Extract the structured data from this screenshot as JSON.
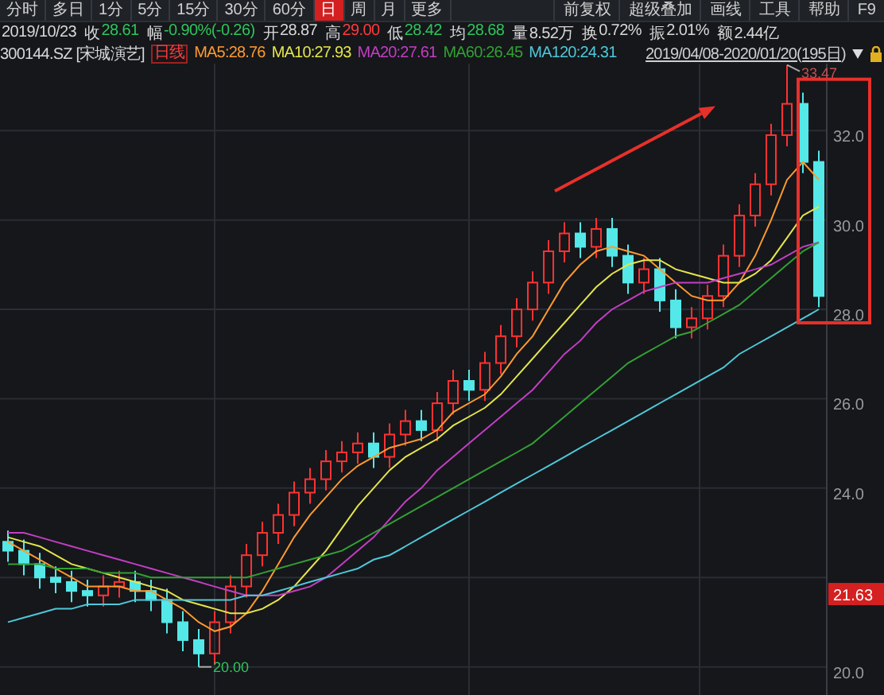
{
  "period_tabs": [
    {
      "label": "分时",
      "selected": false
    },
    {
      "label": "多日",
      "selected": false
    },
    {
      "label": "1分",
      "selected": false
    },
    {
      "label": "5分",
      "selected": false
    },
    {
      "label": "15分",
      "selected": false
    },
    {
      "label": "30分",
      "selected": false
    },
    {
      "label": "60分",
      "selected": false
    },
    {
      "label": "日",
      "selected": true
    },
    {
      "label": "周",
      "selected": false
    },
    {
      "label": "月",
      "selected": false
    },
    {
      "label": "更多",
      "selected": false
    }
  ],
  "tools": [
    "前复权",
    "超级叠加",
    "画线",
    "工具",
    "帮助",
    "F9"
  ],
  "quote": {
    "date": "2019/10/23",
    "items": [
      {
        "label": "收",
        "value": "28.61",
        "color": "#2fc45a"
      },
      {
        "label": "幅",
        "value": "-0.90%(-0.26)",
        "color": "#2fc45a"
      },
      {
        "label": "开",
        "value": "28.87",
        "color": "#d8d8d8"
      },
      {
        "label": "高",
        "value": "29.00",
        "color": "#ff3b3b"
      },
      {
        "label": "低",
        "value": "28.42",
        "color": "#2fc45a"
      },
      {
        "label": "均",
        "value": "28.68",
        "color": "#2fc45a"
      },
      {
        "label": "量",
        "value": "8.52万",
        "color": "#d8d8d8"
      },
      {
        "label": "换",
        "value": "0.72%",
        "color": "#d8d8d8"
      },
      {
        "label": "振",
        "value": "2.01%",
        "color": "#d8d8d8"
      },
      {
        "label": "额",
        "value": "2.44亿",
        "color": "#d8d8d8"
      }
    ]
  },
  "legend": {
    "symbol": "300144.SZ [宋城演艺]",
    "period": "日线",
    "range": "2019/04/08-2020/01/20(195日)",
    "locked": true
  },
  "chart_data": {
    "type": "candlestick",
    "grid": true,
    "ylim": [
      19.3,
      33.5
    ],
    "yticks": [
      {
        "value": 20,
        "label": "20.0"
      },
      {
        "value": 24,
        "label": "24.0"
      },
      {
        "value": 26,
        "label": "26.0"
      },
      {
        "value": 28,
        "label": "28.0"
      },
      {
        "value": 30,
        "label": "30.0"
      },
      {
        "value": 32,
        "label": "32.0"
      }
    ],
    "ohlc": [
      [
        22.8,
        23.05,
        22.35,
        22.6
      ],
      [
        22.6,
        22.85,
        22.05,
        22.3
      ],
      [
        22.3,
        22.55,
        21.75,
        22.0
      ],
      [
        22.0,
        22.25,
        21.65,
        21.9
      ],
      [
        21.9,
        22.15,
        21.45,
        21.7
      ],
      [
        21.7,
        21.95,
        21.35,
        21.6
      ],
      [
        21.6,
        22.05,
        21.35,
        21.8
      ],
      [
        21.8,
        22.15,
        21.55,
        21.9
      ],
      [
        21.9,
        22.15,
        21.45,
        21.7
      ],
      [
        21.7,
        21.95,
        21.25,
        21.5
      ],
      [
        21.5,
        21.75,
        20.75,
        21.0
      ],
      [
        21.0,
        21.25,
        20.35,
        20.6
      ],
      [
        20.6,
        20.85,
        20.0,
        20.3
      ],
      [
        20.3,
        21.25,
        20.05,
        21.0
      ],
      [
        21.0,
        22.05,
        20.75,
        21.8
      ],
      [
        21.8,
        22.75,
        21.55,
        22.5
      ],
      [
        22.5,
        23.25,
        22.25,
        23.0
      ],
      [
        23.0,
        23.65,
        22.75,
        23.4
      ],
      [
        23.4,
        24.15,
        23.15,
        23.9
      ],
      [
        23.9,
        24.45,
        23.65,
        24.2
      ],
      [
        24.2,
        24.85,
        23.95,
        24.6
      ],
      [
        24.6,
        25.05,
        24.35,
        24.8
      ],
      [
        24.8,
        25.25,
        24.55,
        25.0
      ],
      [
        25.0,
        25.25,
        24.45,
        24.7
      ],
      [
        24.7,
        25.45,
        24.45,
        25.2
      ],
      [
        25.2,
        25.75,
        24.95,
        25.5
      ],
      [
        25.5,
        25.75,
        25.05,
        25.3
      ],
      [
        25.3,
        26.15,
        25.05,
        25.9
      ],
      [
        25.9,
        26.65,
        25.65,
        26.4
      ],
      [
        26.4,
        26.65,
        25.95,
        26.2
      ],
      [
        26.2,
        27.05,
        25.95,
        26.8
      ],
      [
        26.8,
        27.65,
        26.55,
        27.4
      ],
      [
        27.4,
        28.25,
        27.15,
        28.0
      ],
      [
        28.0,
        28.85,
        27.75,
        28.6
      ],
      [
        28.6,
        29.55,
        28.35,
        29.3
      ],
      [
        29.3,
        29.95,
        29.05,
        29.7
      ],
      [
        29.7,
        29.95,
        29.15,
        29.4
      ],
      [
        29.4,
        30.05,
        29.15,
        29.8
      ],
      [
        29.8,
        30.05,
        28.95,
        29.2
      ],
      [
        29.2,
        29.45,
        28.35,
        28.6
      ],
      [
        28.6,
        29.15,
        28.35,
        28.9
      ],
      [
        28.9,
        29.15,
        27.95,
        28.2
      ],
      [
        28.2,
        28.45,
        27.35,
        27.6
      ],
      [
        27.6,
        28.05,
        27.35,
        27.8
      ],
      [
        27.8,
        28.55,
        27.55,
        28.3
      ],
      [
        28.3,
        29.45,
        28.05,
        29.2
      ],
      [
        29.2,
        30.35,
        28.95,
        30.1
      ],
      [
        30.1,
        31.05,
        29.85,
        30.8
      ],
      [
        30.8,
        32.15,
        30.55,
        31.9
      ],
      [
        31.9,
        33.47,
        31.65,
        32.6
      ],
      [
        32.6,
        32.85,
        31.05,
        31.3
      ],
      [
        31.3,
        31.55,
        28.05,
        28.3
      ]
    ],
    "series": [
      {
        "name": "MA5:28.76",
        "type": "line",
        "color": "#ff9a2e",
        "values": [
          22.8,
          22.6,
          22.4,
          22.2,
          22.0,
          21.8,
          21.8,
          21.8,
          21.7,
          21.7,
          21.5,
          21.3,
          21.0,
          20.8,
          20.9,
          21.2,
          21.7,
          22.3,
          22.9,
          23.4,
          23.8,
          24.2,
          24.5,
          24.7,
          24.9,
          25.0,
          25.1,
          25.3,
          25.7,
          25.9,
          26.1,
          26.5,
          27.0,
          27.4,
          28.0,
          28.6,
          29.0,
          29.3,
          29.4,
          29.3,
          29.2,
          28.9,
          28.6,
          28.3,
          28.2,
          28.2,
          28.6,
          29.2,
          30.0,
          30.9,
          31.3,
          30.9
        ]
      },
      {
        "name": "MA10:27.93",
        "type": "line",
        "color": "#e5e54a",
        "values": [
          22.9,
          22.8,
          22.7,
          22.5,
          22.3,
          22.2,
          22.1,
          22.0,
          21.9,
          21.8,
          21.7,
          21.5,
          21.4,
          21.3,
          21.2,
          21.2,
          21.3,
          21.5,
          21.8,
          22.2,
          22.6,
          23.1,
          23.6,
          24.0,
          24.4,
          24.7,
          24.9,
          25.1,
          25.4,
          25.6,
          25.8,
          26.1,
          26.5,
          26.9,
          27.3,
          27.7,
          28.1,
          28.5,
          28.8,
          29.0,
          29.1,
          29.1,
          28.9,
          28.8,
          28.7,
          28.6,
          28.6,
          28.8,
          29.1,
          29.6,
          30.1,
          30.3
        ]
      },
      {
        "name": "MA20:27.61",
        "type": "line",
        "color": "#c33ec3",
        "values": [
          23.0,
          23.0,
          22.9,
          22.8,
          22.7,
          22.6,
          22.5,
          22.4,
          22.3,
          22.2,
          22.1,
          22.0,
          21.9,
          21.8,
          21.7,
          21.6,
          21.6,
          21.6,
          21.7,
          21.8,
          22.0,
          22.3,
          22.6,
          22.9,
          23.3,
          23.7,
          24.0,
          24.4,
          24.7,
          25.0,
          25.3,
          25.6,
          25.9,
          26.2,
          26.6,
          27.0,
          27.3,
          27.7,
          28.0,
          28.2,
          28.4,
          28.5,
          28.6,
          28.6,
          28.6,
          28.7,
          28.8,
          28.9,
          29.0,
          29.2,
          29.4,
          29.5
        ]
      },
      {
        "name": "MA60:26.45",
        "type": "line",
        "color": "#33a033",
        "values": [
          22.3,
          22.3,
          22.3,
          22.2,
          22.2,
          22.2,
          22.1,
          22.1,
          22.1,
          22.0,
          22.0,
          22.0,
          22.0,
          22.0,
          22.0,
          22.0,
          22.1,
          22.2,
          22.3,
          22.4,
          22.5,
          22.6,
          22.8,
          23.0,
          23.2,
          23.4,
          23.6,
          23.8,
          24.0,
          24.2,
          24.4,
          24.6,
          24.8,
          25.0,
          25.3,
          25.6,
          25.9,
          26.2,
          26.5,
          26.8,
          27.0,
          27.2,
          27.4,
          27.5,
          27.7,
          27.9,
          28.1,
          28.4,
          28.7,
          29.0,
          29.3,
          29.5
        ]
      },
      {
        "name": "MA120:24.31",
        "type": "line",
        "color": "#4fc8d8",
        "values": [
          21.0,
          21.1,
          21.2,
          21.3,
          21.3,
          21.4,
          21.4,
          21.4,
          21.5,
          21.5,
          21.5,
          21.5,
          21.5,
          21.5,
          21.5,
          21.6,
          21.6,
          21.7,
          21.8,
          21.9,
          22.0,
          22.1,
          22.2,
          22.4,
          22.5,
          22.7,
          22.9,
          23.1,
          23.3,
          23.5,
          23.7,
          23.9,
          24.1,
          24.3,
          24.5,
          24.7,
          24.9,
          25.1,
          25.3,
          25.5,
          25.7,
          25.9,
          26.1,
          26.3,
          26.5,
          26.7,
          27.0,
          27.2,
          27.4,
          27.6,
          27.8,
          28.0
        ]
      }
    ],
    "annotations": [
      "33.47",
      "20.00"
    ]
  },
  "drawings": {
    "arrow": true,
    "box": true
  },
  "last_price": "21.63"
}
